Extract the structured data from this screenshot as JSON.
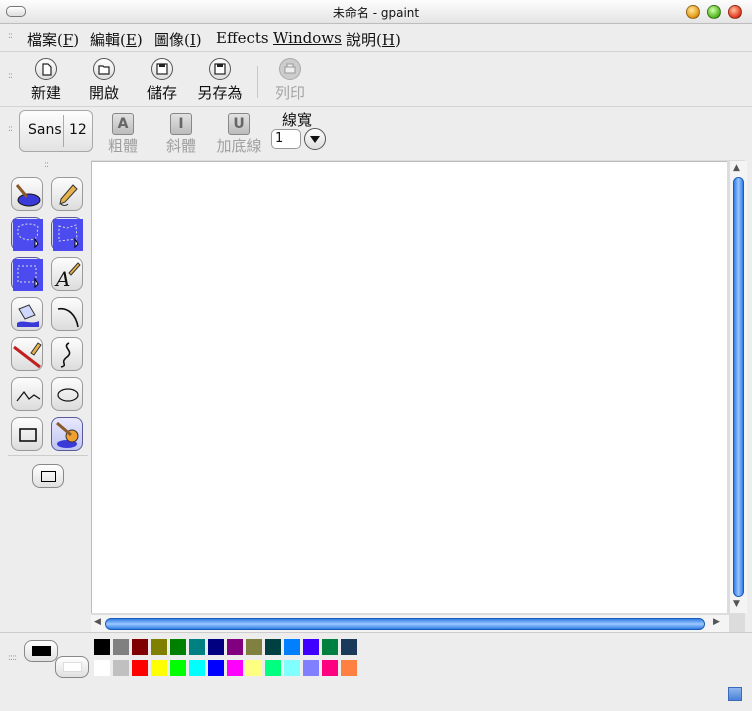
{
  "window": {
    "title": "未命名 - gpaint"
  },
  "menu": [
    {
      "label": "檔案(",
      "mn": "F",
      "end": ")"
    },
    {
      "label": "編輯(",
      "mn": "E",
      "end": ")"
    },
    {
      "label": "圖像(",
      "mn": "I",
      "end": ")"
    },
    {
      "label": "Effects",
      "mn": "",
      "end": ""
    },
    {
      "label": "",
      "mn": "Windows",
      "end": ""
    },
    {
      "label": "說明(",
      "mn": "H",
      "end": ")"
    }
  ],
  "toolbar": {
    "new": "新建",
    "open": "開啟",
    "save": "儲存",
    "save_as": "另存為",
    "print": "列印"
  },
  "fontbar": {
    "font_name": "Sans",
    "font_size": "12",
    "bold": "粗體",
    "bold_icon": "A",
    "italic": "斜體",
    "italic_icon": "I",
    "underline": "加底線",
    "underline_icon": "U",
    "line_width_label": "線寬",
    "line_width_value": "1"
  },
  "tools": [
    {
      "name": "paint-tool",
      "icon": "paint-blob-icon",
      "active": false
    },
    {
      "name": "pencil-tool",
      "icon": "pencil-icon",
      "active": false
    },
    {
      "name": "lasso-select-tool",
      "icon": "lasso-select-icon",
      "active": true
    },
    {
      "name": "freeform-select-tool",
      "icon": "freeform-select-icon",
      "active": true
    },
    {
      "name": "rect-select-tool",
      "icon": "rect-select-icon",
      "active": true
    },
    {
      "name": "text-tool",
      "icon": "text-pen-icon",
      "active": false
    },
    {
      "name": "fill-tool",
      "icon": "paint-bucket-icon",
      "active": false
    },
    {
      "name": "arc-tool",
      "icon": "arc-icon",
      "active": false
    },
    {
      "name": "line-tool",
      "icon": "ruler-pencil-icon",
      "active": false
    },
    {
      "name": "curve-tool",
      "icon": "curve-icon",
      "active": false
    },
    {
      "name": "polyline-tool",
      "icon": "polyline-icon",
      "active": false
    },
    {
      "name": "ellipse-tool",
      "icon": "ellipse-icon",
      "active": false
    },
    {
      "name": "rectangle-tool",
      "icon": "rectangle-icon",
      "active": false
    },
    {
      "name": "brush-tool",
      "icon": "brush-palette-icon",
      "active": true
    }
  ],
  "colors": {
    "foreground": "#000000",
    "background": "#ffffff",
    "palette_row1": [
      "#000000",
      "#808080",
      "#800000",
      "#808000",
      "#008000",
      "#008080",
      "#000080",
      "#800080",
      "#808040",
      "#004040",
      "#0080ff",
      "#4000ff",
      "#008040",
      "#1a3a5c"
    ],
    "palette_row2": [
      "#ffffff",
      "#c0c0c0",
      "#ff0000",
      "#ffff00",
      "#00ff00",
      "#00ffff",
      "#0000ff",
      "#ff00ff",
      "#ffff80",
      "#00ff80",
      "#80ffff",
      "#8080ff",
      "#ff0080",
      "#ff8040"
    ]
  }
}
